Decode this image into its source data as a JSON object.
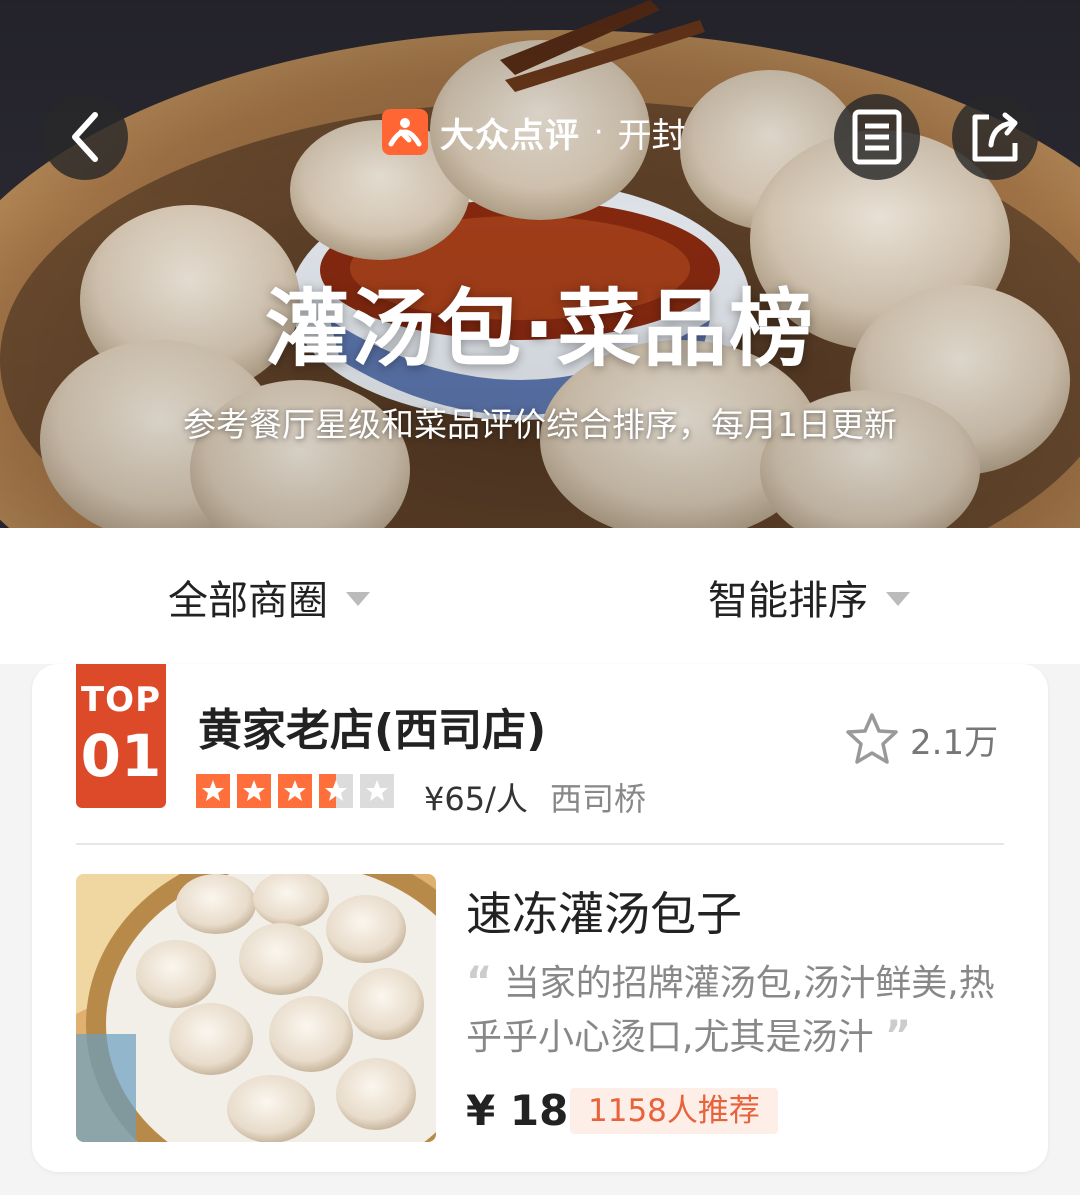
{
  "header": {
    "brand_name": "大众点评",
    "separator": "·",
    "city": "开封",
    "title": "灌汤包·菜品榜",
    "subtitle": "参考餐厅星级和菜品评价综合排序，每月1日更新"
  },
  "filters": {
    "area_label": "全部商圈",
    "sort_label": "智能排序"
  },
  "ranking": [
    {
      "rank_prefix": "TOP",
      "rank_number": "01",
      "shop_name": "黄家老店(西司店)",
      "favorite_count": "2.1万",
      "rating_stars": 3.5,
      "price_per_person": "¥65/人",
      "area": "西司桥",
      "dish": {
        "name": "速冻灌汤包子",
        "quote": "当家的招牌灌汤包,汤汁鲜美,热乎乎小心烫口,尤其是汤汁",
        "price": "¥ 18",
        "recommend": "1158人推荐"
      }
    }
  ],
  "colors": {
    "accent": "#dd4a2a",
    "brand_orange": "#ff6633",
    "star_active": "#ff6f3c",
    "star_inactive": "#dcdcdc",
    "recommend_bg": "#fdeee8",
    "recommend_text": "#e8623a"
  },
  "icons": {
    "back": "chevron-left-icon",
    "list": "list-icon",
    "share": "share-icon",
    "favorite": "star-outline-icon",
    "dropdown": "caret-down-icon"
  }
}
